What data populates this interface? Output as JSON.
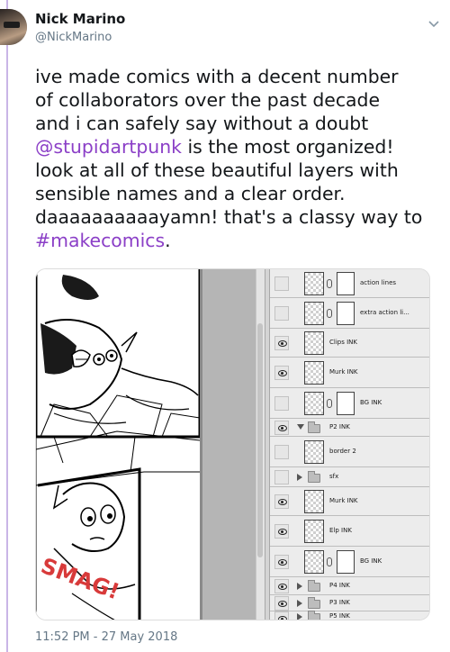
{
  "tweet": {
    "author_name": "Nick Marino",
    "author_handle": "@NickMarino",
    "text_before": "ive made comics with a decent number\nof collaborators over the past decade\nand i can safely say without a doubt\n",
    "mention": "@stupidartpunk",
    "text_middle": " is the most organized!\nlook at all of these beautiful layers with\nsensible names and a clear order.\ndaaaaaaaaaayamn! that's a classy way to\n",
    "hashtag": "#makecomics",
    "text_after": ".",
    "timestamp": "11:52 PM - 27 May 2018"
  },
  "comic": {
    "sfx_text": "SMAG!"
  },
  "layers_panel": {
    "layers": [
      {
        "label": "action lines",
        "visible": false
      },
      {
        "label": "extra action li...",
        "visible": false
      },
      {
        "label": "Clips INK",
        "visible": true
      },
      {
        "label": "Murk INK",
        "visible": true
      },
      {
        "label": "BG INK",
        "visible": false
      },
      {
        "label": "P2 INK",
        "visible": true,
        "group": true,
        "expanded": true
      },
      {
        "label": "border 2",
        "visible": false
      },
      {
        "label": "sfx",
        "visible": false,
        "group": true,
        "expanded": false
      },
      {
        "label": "Murk INK",
        "visible": true
      },
      {
        "label": "Elp INK",
        "visible": true
      },
      {
        "label": "BG INK",
        "visible": true
      },
      {
        "label": "P4 INK",
        "visible": true,
        "group": true,
        "expanded": false
      },
      {
        "label": "P3 INK",
        "visible": true,
        "group": true,
        "expanded": false
      },
      {
        "label": "P5 INK",
        "visible": true,
        "group": true,
        "expanded": false
      }
    ]
  },
  "colors": {
    "link": "#8b3fc7",
    "thread_line": "#c9b5e6",
    "muted_text": "#657786"
  }
}
